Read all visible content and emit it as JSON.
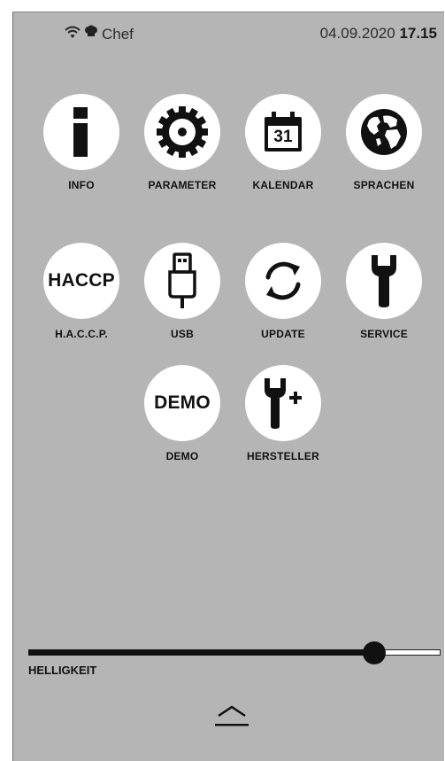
{
  "status": {
    "user": "Chef",
    "date": "04.09.2020",
    "time": "17.15"
  },
  "menu": [
    {
      "label": "INFO",
      "icon": "info-icon"
    },
    {
      "label": "PARAMETER",
      "icon": "gear-icon"
    },
    {
      "label": "KALENDAR",
      "icon": "calendar-icon",
      "icon_text": "31"
    },
    {
      "label": "SPRACHEN",
      "icon": "globe-icon"
    },
    {
      "label": "H.A.C.C.P.",
      "icon": "haccp-icon",
      "icon_text": "HACCP"
    },
    {
      "label": "USB",
      "icon": "usb-icon"
    },
    {
      "label": "UPDATE",
      "icon": "refresh-icon"
    },
    {
      "label": "SERVICE",
      "icon": "wrench-icon"
    },
    {
      "label": "DEMO",
      "icon": "demo-icon",
      "icon_text": "DEMO"
    },
    {
      "label": "HERSTELLER",
      "icon": "wrench-plus-icon"
    }
  ],
  "brightness": {
    "label": "HELLIGKEIT",
    "level_fraction": 0.84
  }
}
